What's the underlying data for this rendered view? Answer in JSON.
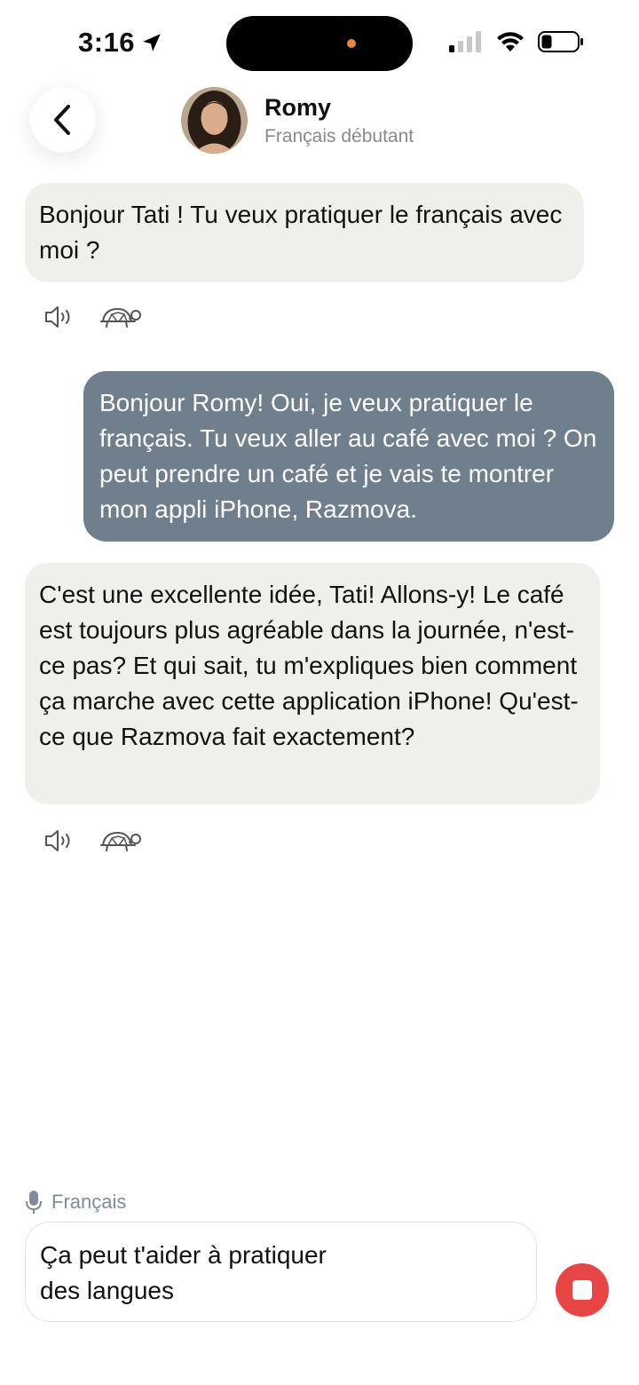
{
  "status_bar": {
    "time": "3:16",
    "icons": [
      "location-arrow-icon",
      "cellular-signal-icon",
      "wifi-icon",
      "battery-icon"
    ]
  },
  "header": {
    "back_icon": "chevron-left-icon",
    "name": "Romy",
    "subtitle": "Français débutant"
  },
  "messages": [
    {
      "role": "assistant",
      "text": "Bonjour Tati ! Tu veux pratiquer le français avec moi ?"
    },
    {
      "role": "user",
      "text": "Bonjour Romy! Oui, je veux pratiquer le français. Tu veux aller au café avec moi ? On peut prendre un café et je vais te montrer mon appli iPhone, Razmova."
    },
    {
      "role": "assistant",
      "text": "C'est une excellente idée, Tati! Allons-y! Le café est toujours plus agréable dans la journée, n'est-ce pas? Et qui sait, tu m'expliques bien comment ça marche avec cette application iPhone! Qu'est-ce que Razmova fait exactement?"
    }
  ],
  "message_actions": [
    "speaker-icon",
    "turtle-icon"
  ],
  "composer": {
    "language": "Français",
    "text": "Ça peut t'aider à pratiquer\ndes langues",
    "stop_icon": "stop-icon"
  },
  "colors": {
    "assistant_bubble": "#f0f0eb",
    "user_bubble": "#6f7f8e",
    "stop_button": "#e84545",
    "muted_text": "#8a8a8a"
  }
}
